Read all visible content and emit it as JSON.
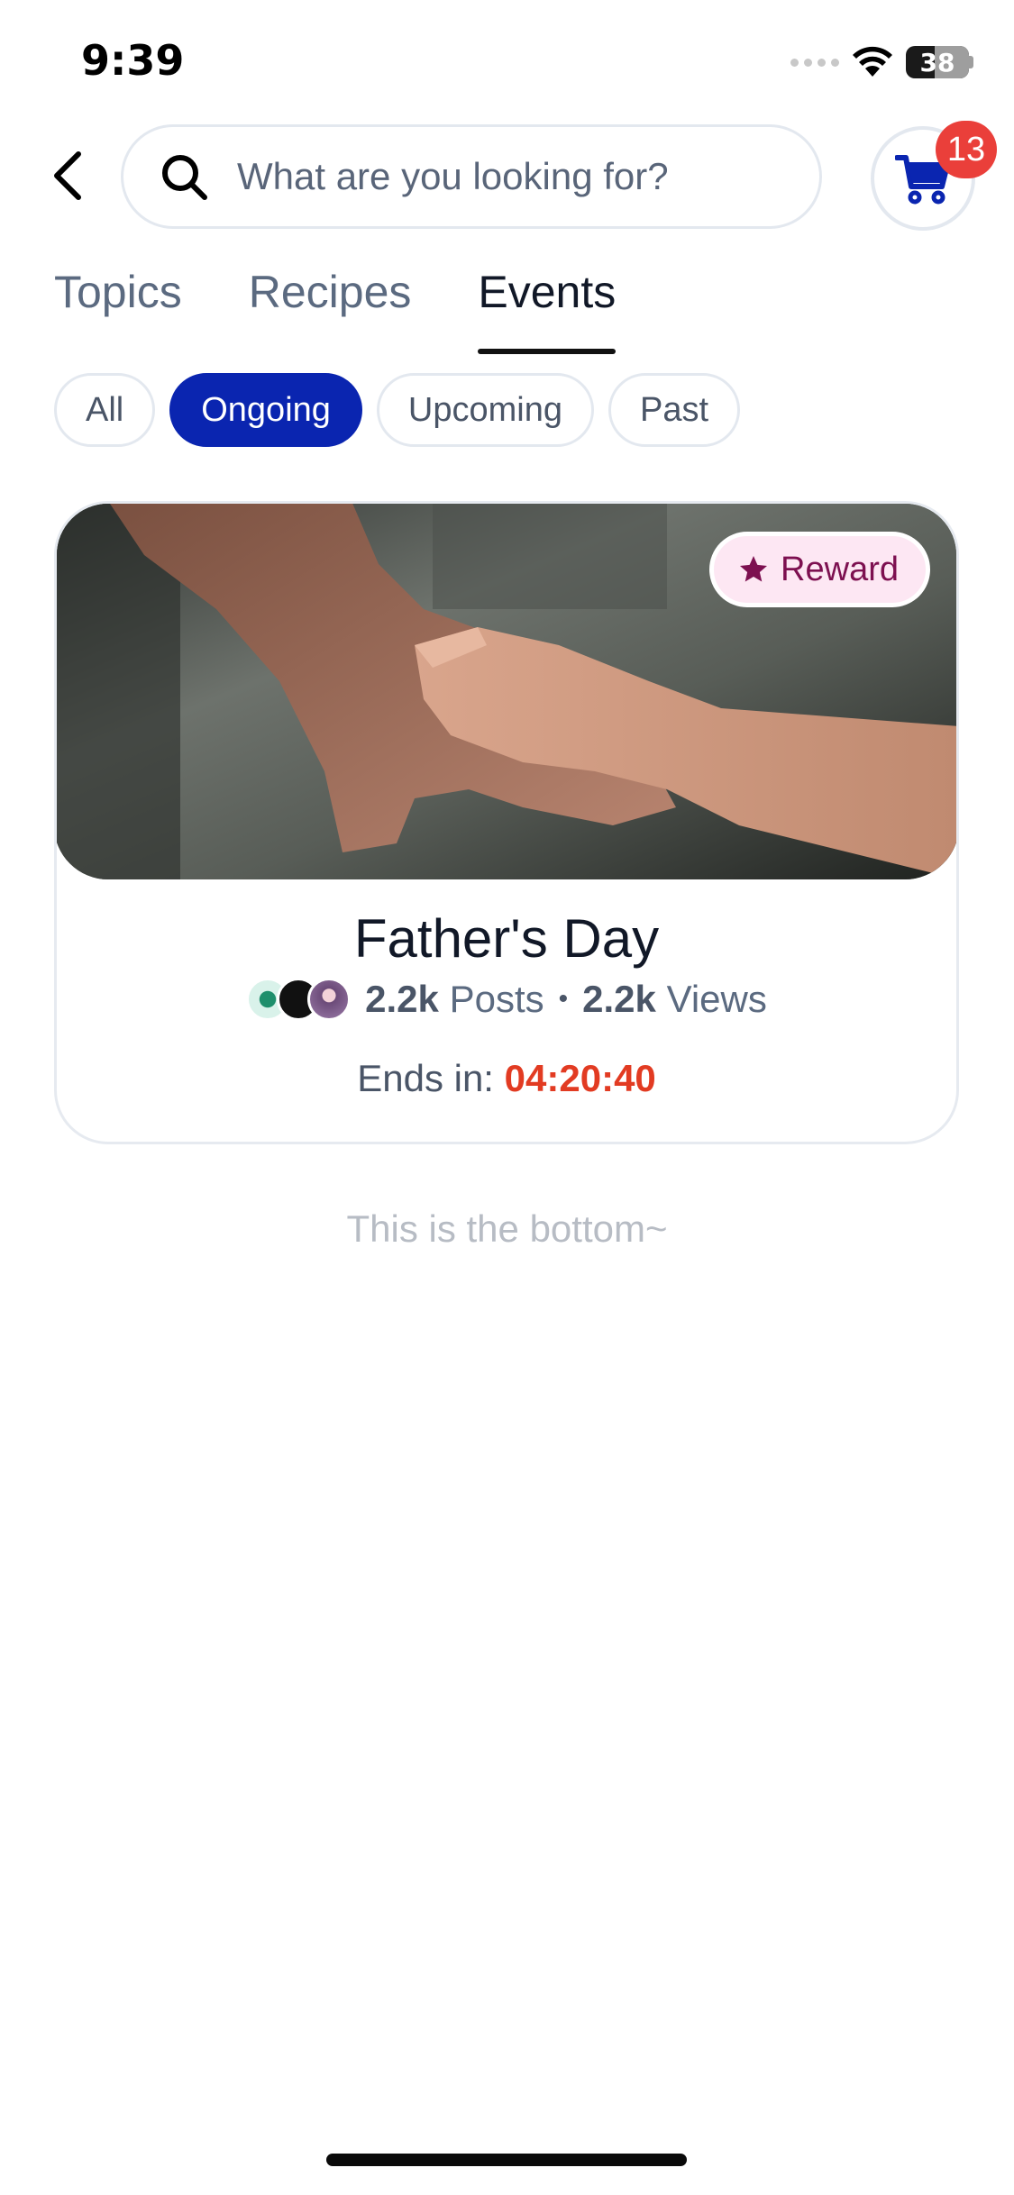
{
  "status_bar": {
    "time": "9:39",
    "battery": "38"
  },
  "header": {
    "search_placeholder": "What are you looking for?",
    "cart_badge": "13"
  },
  "tabs": [
    {
      "label": "Topics",
      "active": false
    },
    {
      "label": "Recipes",
      "active": false
    },
    {
      "label": "Events",
      "active": true
    }
  ],
  "filters": [
    {
      "label": "All",
      "active": false
    },
    {
      "label": "Ongoing",
      "active": true
    },
    {
      "label": "Upcoming",
      "active": false
    },
    {
      "label": "Past",
      "active": false
    }
  ],
  "event": {
    "badge_label": "Reward",
    "title": "Father's Day",
    "posts_count": "2.2k",
    "posts_label": "Posts",
    "views_count": "2.2k",
    "views_label": "Views",
    "separator": "•",
    "ends_label": "Ends in:",
    "countdown": "04:20:40"
  },
  "footer_note": "This is the bottom~",
  "colors": {
    "accent": "#0a25b0",
    "badge_red": "#ea3f3a",
    "countdown": "#e23b22",
    "reward_bg": "#fde7f3",
    "reward_text": "#7d1050"
  },
  "icons": [
    "back-chevron-icon",
    "search-icon",
    "cart-icon",
    "star-icon",
    "wifi-icon",
    "battery-icon"
  ]
}
